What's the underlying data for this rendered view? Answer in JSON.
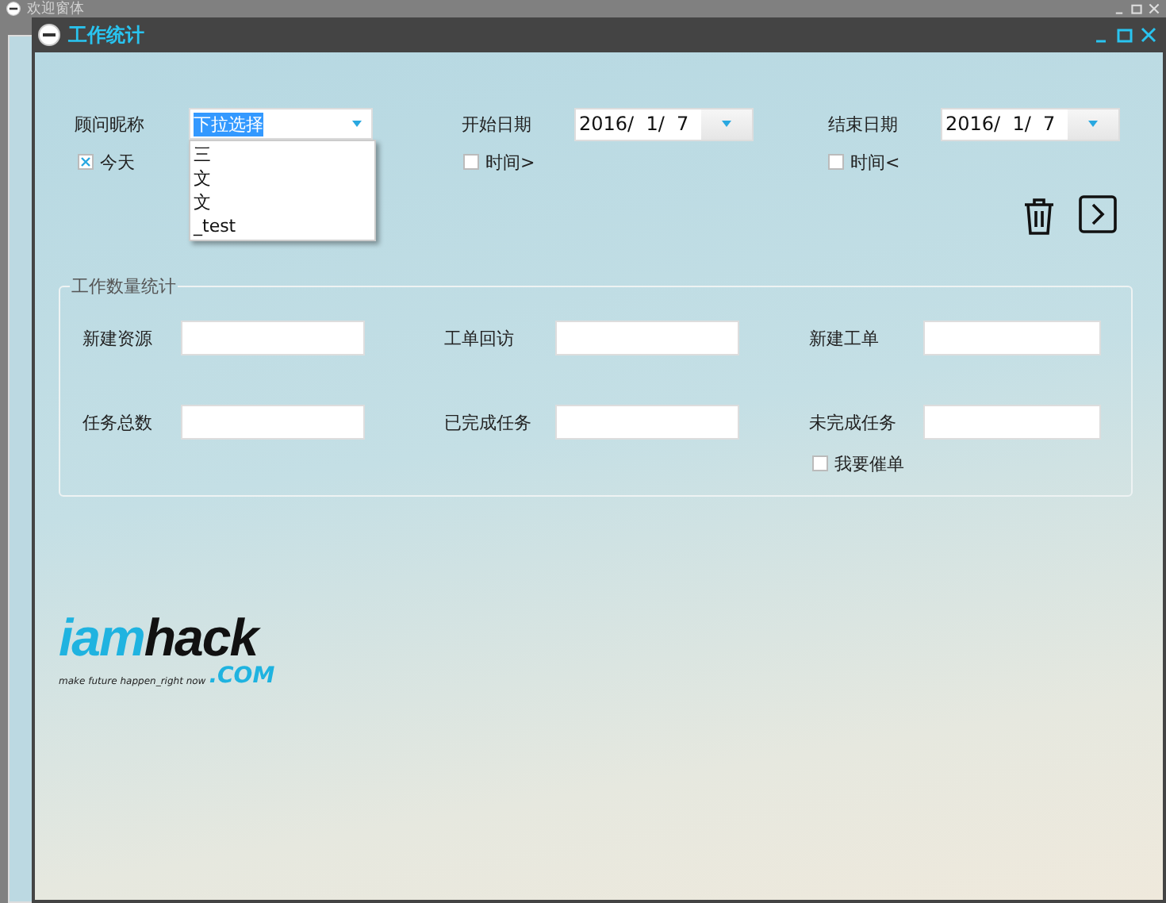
{
  "background_window": {
    "title": "欢迎窗体"
  },
  "window": {
    "title": "工作统计"
  },
  "filters": {
    "advisor": {
      "label": "顾问昵称",
      "value": "下拉选择",
      "expanded": true,
      "options": [
        "三",
        "文",
        "文",
        "_test"
      ]
    },
    "start_date": {
      "label": "开始日期",
      "value": "2016/  1/  7"
    },
    "end_date": {
      "label": "结束日期",
      "value": "2016/  1/  7"
    },
    "checks": [
      {
        "label": "今天",
        "checked": true
      },
      {
        "label": "时间>",
        "checked": false
      },
      {
        "label": "时间<",
        "checked": false
      }
    ]
  },
  "stats": {
    "title": "工作数量统计",
    "fields": [
      {
        "label": "新建资源"
      },
      {
        "label": "工单回访"
      },
      {
        "label": "新建工单"
      },
      {
        "label": "任务总数"
      },
      {
        "label": "已完成任务"
      },
      {
        "label": "未完成任务"
      }
    ],
    "urge": {
      "label": "我要催单",
      "checked": false
    }
  },
  "logo": {
    "brand_start": "iam",
    "brand_end": "hack",
    "tagline": "make future happen_right now",
    "domain": ".COM"
  }
}
